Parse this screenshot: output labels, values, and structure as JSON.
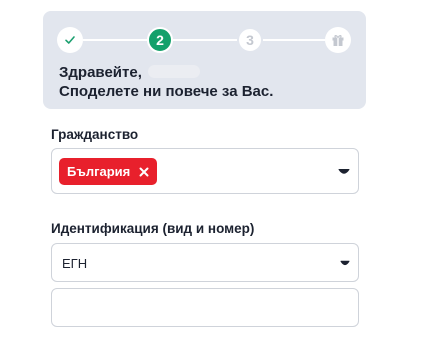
{
  "stepper": {
    "steps": [
      {
        "state": "done",
        "icon": "check-icon"
      },
      {
        "state": "active",
        "number": "2"
      },
      {
        "state": "todo",
        "number": "3"
      },
      {
        "state": "todo",
        "icon": "gift-icon"
      }
    ],
    "colors": {
      "active": "#14a06b",
      "done": "#1ca070",
      "todo": "#c4c8d0"
    }
  },
  "greeting": {
    "line1": "Здравейте,",
    "line2": "Споделете ни повече за Вас."
  },
  "citizenship": {
    "label": "Гражданство",
    "selected_tag": "България",
    "tag_color": "#e8202c"
  },
  "identification": {
    "label": "Идентификация (вид и номер)",
    "type_value": "ЕГН",
    "number_value": ""
  }
}
